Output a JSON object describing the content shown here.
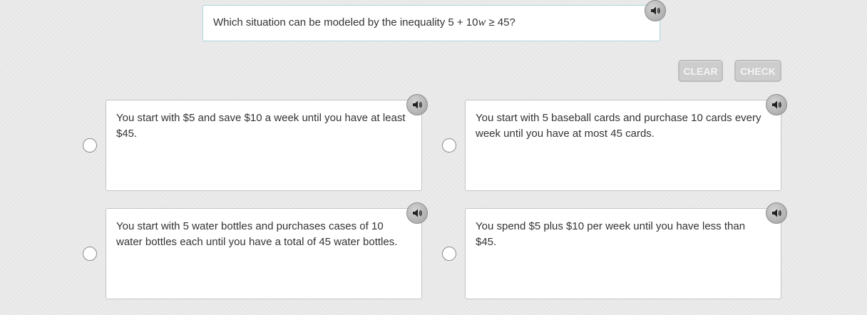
{
  "question": {
    "prefix": "Which situation can be modeled by the inequality 5 + 10",
    "variable": "w",
    "suffix": " ≥ 45?"
  },
  "toolbar": {
    "clear_label": "CLEAR",
    "check_label": "CHECK"
  },
  "options": [
    {
      "text": "You start with $5 and save $10 a week until you have at least $45."
    },
    {
      "text": "You start with 5 baseball cards and purchase 10 cards every week until you have at most 45 cards."
    },
    {
      "text": "You start with 5 water bottles and purchases cases of 10 water bottles each until you have a total of 45 water bottles."
    },
    {
      "text": "You spend $5 plus $10 per week until you have less than $45."
    }
  ],
  "icons": {
    "speaker": "speaker-icon"
  },
  "colors": {
    "background": "#e9e9e9",
    "question_border": "#a9d6de",
    "button_disabled": "#cdcdcd",
    "text": "#333333"
  }
}
